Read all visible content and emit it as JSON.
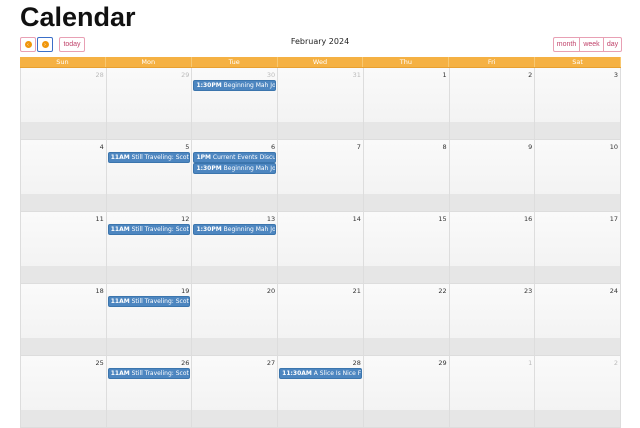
{
  "title": "Calendar",
  "toolbar": {
    "prev_icon": "chevron-left-icon",
    "next_icon": "chevron-right-icon",
    "today": "today",
    "month_title": "February 2024",
    "views": [
      "month",
      "week",
      "day"
    ]
  },
  "days": [
    "Sun",
    "Mon",
    "Tue",
    "Wed",
    "Thu",
    "Fri",
    "Sat"
  ],
  "weeks": [
    [
      {
        "d": "28",
        "o": true
      },
      {
        "d": "29",
        "o": true
      },
      {
        "d": "30",
        "o": true,
        "ev": [
          {
            "t": "1:30PM",
            "n": "Beginning Mah Jong"
          }
        ]
      },
      {
        "d": "31",
        "o": true
      },
      {
        "d": "1"
      },
      {
        "d": "2"
      },
      {
        "d": "3"
      }
    ],
    [
      {
        "d": "4"
      },
      {
        "d": "5",
        "ev": [
          {
            "t": "11AM",
            "n": "Still Traveling: Scotland"
          }
        ]
      },
      {
        "d": "6",
        "ev": [
          {
            "t": "1PM",
            "n": "Current Events Discussion"
          },
          {
            "t": "1:30PM",
            "n": "Beginning Mah Jong"
          }
        ]
      },
      {
        "d": "7"
      },
      {
        "d": "8"
      },
      {
        "d": "9"
      },
      {
        "d": "10"
      }
    ],
    [
      {
        "d": "11"
      },
      {
        "d": "12",
        "ev": [
          {
            "t": "11AM",
            "n": "Still Traveling: Scotland"
          }
        ]
      },
      {
        "d": "13",
        "ev": [
          {
            "t": "1:30PM",
            "n": "Beginning Mah Jong"
          }
        ]
      },
      {
        "d": "14"
      },
      {
        "d": "15"
      },
      {
        "d": "16"
      },
      {
        "d": "17"
      }
    ],
    [
      {
        "d": "18"
      },
      {
        "d": "19",
        "ev": [
          {
            "t": "11AM",
            "n": "Still Traveling: Scotland"
          }
        ]
      },
      {
        "d": "20"
      },
      {
        "d": "21"
      },
      {
        "d": "22"
      },
      {
        "d": "23"
      },
      {
        "d": "24"
      }
    ],
    [
      {
        "d": "25"
      },
      {
        "d": "26",
        "ev": [
          {
            "t": "11AM",
            "n": "Still Traveling: Scotland"
          }
        ]
      },
      {
        "d": "27"
      },
      {
        "d": "28",
        "ev": [
          {
            "t": "11:30AM",
            "n": "A Slice Is Nice Fun"
          }
        ]
      },
      {
        "d": "29"
      },
      {
        "d": "1",
        "o": true
      },
      {
        "d": "2",
        "o": true
      }
    ]
  ]
}
